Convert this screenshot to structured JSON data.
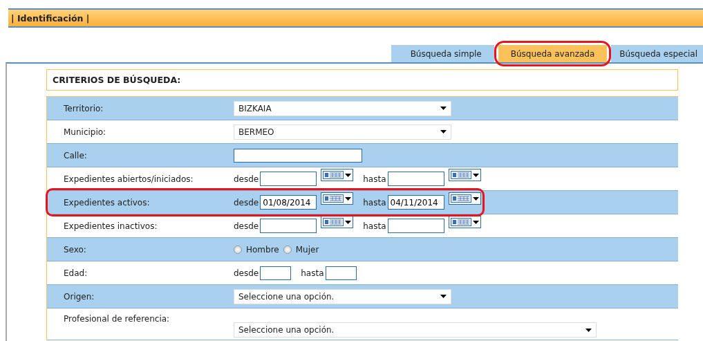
{
  "header": {
    "title": "| Identificación |"
  },
  "tabs": [
    {
      "label": "Búsqueda simple",
      "selected": false
    },
    {
      "label": "Búsqueda avanzada",
      "selected": true,
      "highlighted": true
    },
    {
      "label": "Búsqueda especial",
      "selected": false
    }
  ],
  "criteria": {
    "title": "CRITERIOS DE BÚSQUEDA:"
  },
  "rows": [
    {
      "kind": "select",
      "label": "Territorio:",
      "value": "BIZKAIA"
    },
    {
      "kind": "select",
      "label": "Municipio:",
      "value": "BERMEO"
    },
    {
      "kind": "text",
      "label": "Calle:"
    },
    {
      "kind": "daterange",
      "label": "Expedientes abiertos/iniciados:",
      "from_label": "desde",
      "to_label": "hasta"
    },
    {
      "kind": "daterange",
      "label": "Expedientes activos:",
      "from_label": "desde",
      "from_value": "01/08/2014",
      "to_label": "hasta",
      "to_value": "04/11/2014",
      "highlighted": true
    },
    {
      "kind": "daterange",
      "label": "Expedientes inactivos:",
      "from_label": "desde",
      "to_label": "hasta"
    },
    {
      "kind": "radio",
      "label": "Sexo:",
      "options": [
        {
          "label": "Hombre",
          "selected": false
        },
        {
          "label": "Mujer",
          "selected": false
        }
      ]
    },
    {
      "kind": "numrange",
      "label": "Edad:",
      "from_label": "desde",
      "to_label": "hasta"
    },
    {
      "kind": "select",
      "label": "Origen:",
      "value": "Seleccione una opción."
    },
    {
      "kind": "wideselect",
      "label": "Profesional de referencia:",
      "value": "Seleccione una opción."
    }
  ]
}
